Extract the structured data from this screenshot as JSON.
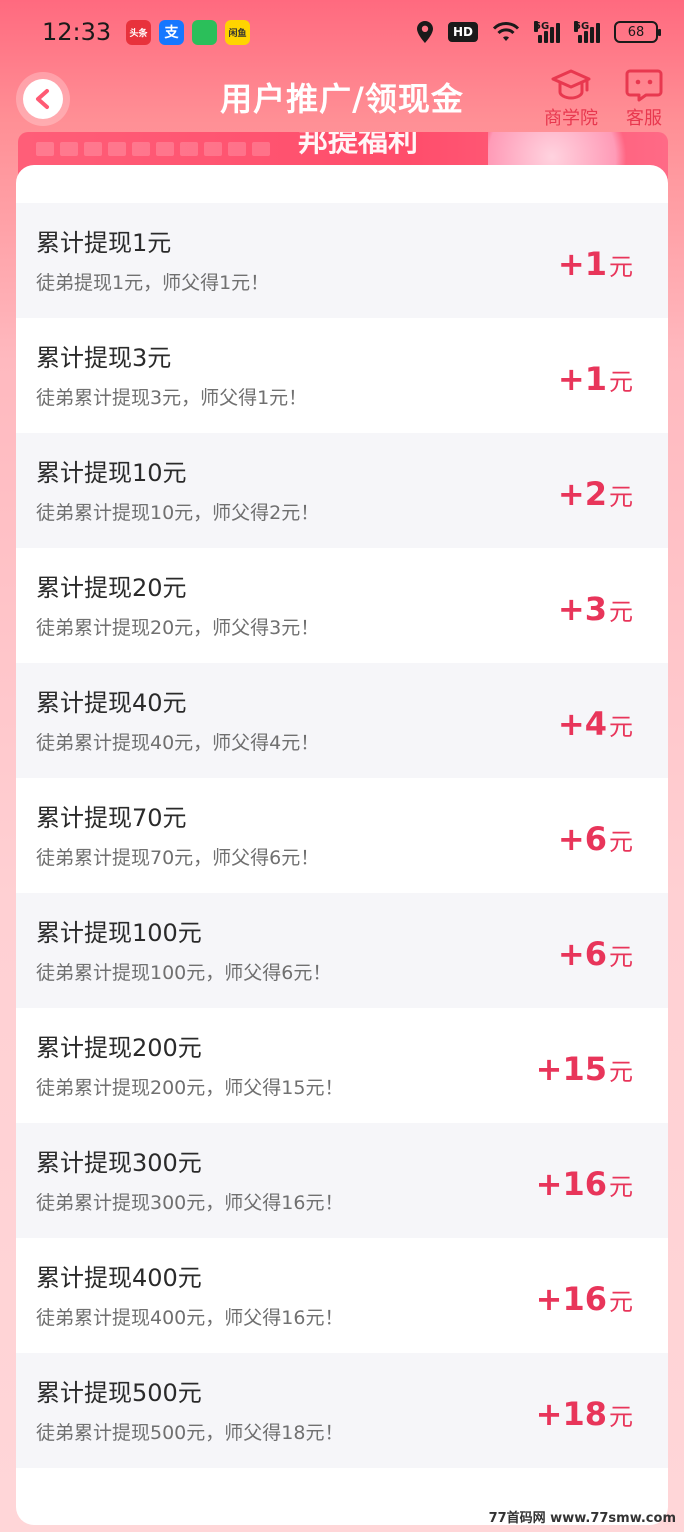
{
  "status_bar": {
    "time": "12:33",
    "apps": [
      {
        "label": "头条",
        "color": "#e8323c"
      },
      {
        "label": "支",
        "color": "#1677ff"
      },
      {
        "label": "",
        "color": "#2bbf5a"
      },
      {
        "label": "闲鱼",
        "color": "#ffd400"
      }
    ],
    "hd": "HD",
    "net1": "5G",
    "net2": "5G",
    "battery": "68"
  },
  "header": {
    "title": "用户推广/领现金",
    "academy_label": "商学院",
    "service_label": "客服"
  },
  "banner": {
    "text": "邦提福利"
  },
  "rewards": [
    {
      "title": "累计提现1元",
      "desc": "徒弟提现1元，师父得1元！",
      "amount": "+1",
      "unit": "元"
    },
    {
      "title": "累计提现3元",
      "desc": "徒弟累计提现3元，师父得1元！",
      "amount": "+1",
      "unit": "元"
    },
    {
      "title": "累计提现10元",
      "desc": "徒弟累计提现10元，师父得2元！",
      "amount": "+2",
      "unit": "元"
    },
    {
      "title": "累计提现20元",
      "desc": "徒弟累计提现20元，师父得3元！",
      "amount": "+3",
      "unit": "元"
    },
    {
      "title": "累计提现40元",
      "desc": "徒弟累计提现40元，师父得4元！",
      "amount": "+4",
      "unit": "元"
    },
    {
      "title": "累计提现70元",
      "desc": "徒弟累计提现70元，师父得6元！",
      "amount": "+6",
      "unit": "元"
    },
    {
      "title": "累计提现100元",
      "desc": "徒弟累计提现100元，师父得6元！",
      "amount": "+6",
      "unit": "元"
    },
    {
      "title": "累计提现200元",
      "desc": "徒弟累计提现200元，师父得15元！",
      "amount": "+15",
      "unit": "元"
    },
    {
      "title": "累计提现300元",
      "desc": "徒弟累计提现300元，师父得16元！",
      "amount": "+16",
      "unit": "元"
    },
    {
      "title": "累计提现400元",
      "desc": "徒弟累计提现400元，师父得16元！",
      "amount": "+16",
      "unit": "元"
    },
    {
      "title": "累计提现500元",
      "desc": "徒弟累计提现500元，师父得18元！",
      "amount": "+18",
      "unit": "元"
    }
  ],
  "watermark": "77首码网 www.77smw.com",
  "colors": {
    "accent": "#e8355a",
    "header_gradient_top": "#ff6a7f",
    "row_alt": "#f6f6f9"
  }
}
